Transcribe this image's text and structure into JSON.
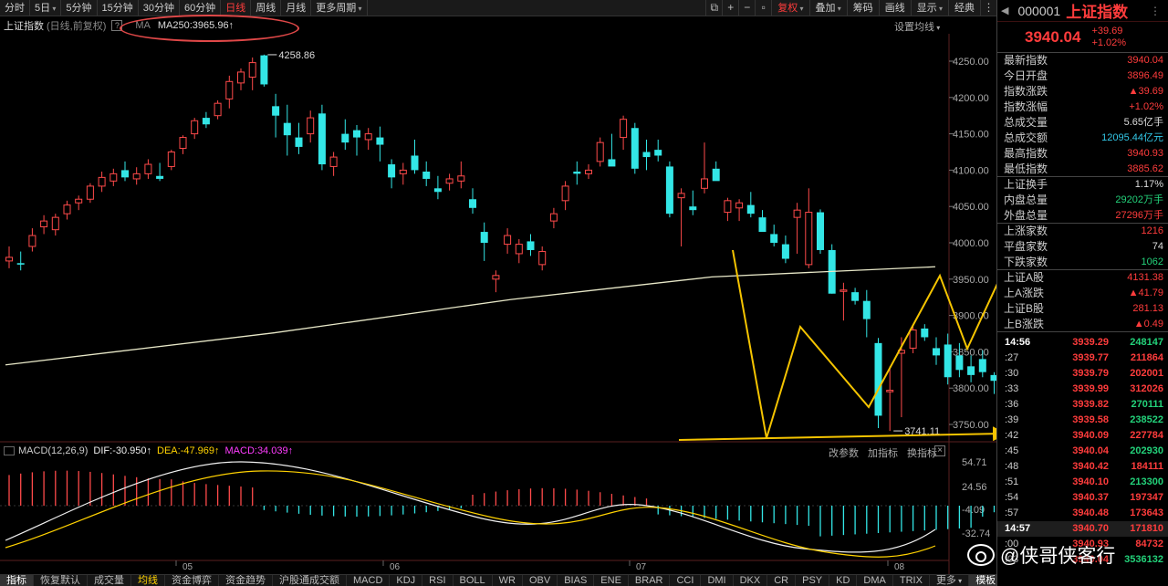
{
  "toolbar": {
    "periods": [
      "分时",
      "5日",
      "5分钟",
      "15分钟",
      "30分钟",
      "60分钟",
      "日线",
      "周线",
      "月线",
      "更多周期"
    ],
    "active_period": "日线",
    "right_buttons": [
      "复权",
      "叠加",
      "筹码",
      "画线",
      "显示",
      "经典"
    ]
  },
  "info": {
    "index_name": "上证指数",
    "options": "(日线,前复权)",
    "ma_label": "MA",
    "ma_value": "MA250:3965.96↑",
    "settings": "设置均线"
  },
  "price_axis": [
    "4250.00",
    "4200.00",
    "4150.00",
    "4100.00",
    "4050.00",
    "4000.00",
    "3950.00",
    "3900.00",
    "3850.00",
    "3800.00",
    "3750.00"
  ],
  "annotations": {
    "high": "4258.86",
    "low": "3741.11"
  },
  "macd": {
    "name": "MACD(12,26,9)",
    "dif": "DIF:-30.950↑",
    "dea": "DEA:-47.969↑",
    "macd": "MACD:34.039↑",
    "tools": [
      "改参数",
      "加指标",
      "换指标"
    ],
    "axis": [
      "54.71",
      "24.56",
      "-4.09",
      "-32.74"
    ]
  },
  "months": [
    "05",
    "06",
    "07",
    "08"
  ],
  "indicators": [
    "指标",
    "恢复默认",
    "成交量",
    "均线",
    "资金博弈",
    "资金趋势",
    "沪股通成交额",
    "MACD",
    "KDJ",
    "RSI",
    "BOLL",
    "WR",
    "OBV",
    "BIAS",
    "ENE",
    "BRAR",
    "CCI",
    "DMI",
    "DKX",
    "CR",
    "PSY",
    "KD",
    "DMA",
    "TRIX",
    "更多",
    "模板"
  ],
  "panel": {
    "code": "000001",
    "name": "上证指数",
    "price": "3940.04",
    "change": "+39.69",
    "change_pct": "+1.02%",
    "stats": [
      {
        "label": "最新指数",
        "value": "3940.04",
        "color": "red"
      },
      {
        "label": "今日开盘",
        "value": "3896.49",
        "color": "red"
      },
      {
        "label": "指数涨跌",
        "value": "▲39.69",
        "color": "red"
      },
      {
        "label": "指数涨幅",
        "value": "+1.02%",
        "color": "red"
      },
      {
        "label": "总成交量",
        "value": "5.65亿手",
        "color": "white"
      },
      {
        "label": "总成交额",
        "value": "12095.44亿元",
        "color": "cyan"
      },
      {
        "label": "最高指数",
        "value": "3940.93",
        "color": "red"
      },
      {
        "label": "最低指数",
        "value": "3885.62",
        "color": "red"
      }
    ],
    "stats2": [
      {
        "label": "上证换手",
        "value": "1.17%",
        "color": "white"
      },
      {
        "label": "内盘总量",
        "value": "29202万手",
        "color": "green"
      },
      {
        "label": "外盘总量",
        "value": "27296万手",
        "color": "red"
      }
    ],
    "stats3": [
      {
        "label": "上涨家数",
        "value": "1216",
        "color": "red"
      },
      {
        "label": "平盘家数",
        "value": "74",
        "color": "white"
      },
      {
        "label": "下跌家数",
        "value": "1062",
        "color": "green"
      }
    ],
    "stats4": [
      {
        "label": "上证A股",
        "value": "4131.38",
        "color": "red"
      },
      {
        "label": "上A涨跌",
        "value": "▲41.79",
        "color": "red"
      },
      {
        "label": "上证B股",
        "value": "281.13",
        "color": "red"
      },
      {
        "label": "上B涨跌",
        "value": "▲0.49",
        "color": "red"
      }
    ],
    "ticks": [
      {
        "t": "14:56",
        "p": "3939.29",
        "v": "248147",
        "pc": "red",
        "vc": "green",
        "strong": true
      },
      {
        "t": ":27",
        "p": "3939.77",
        "v": "211864",
        "pc": "red",
        "vc": "red"
      },
      {
        "t": ":30",
        "p": "3939.79",
        "v": "202001",
        "pc": "red",
        "vc": "red"
      },
      {
        "t": ":33",
        "p": "3939.99",
        "v": "312026",
        "pc": "red",
        "vc": "red"
      },
      {
        "t": ":36",
        "p": "3939.82",
        "v": "270111",
        "pc": "red",
        "vc": "green"
      },
      {
        "t": ":39",
        "p": "3939.58",
        "v": "238522",
        "pc": "red",
        "vc": "green"
      },
      {
        "t": ":42",
        "p": "3940.09",
        "v": "227784",
        "pc": "red",
        "vc": "red"
      },
      {
        "t": ":45",
        "p": "3940.04",
        "v": "202930",
        "pc": "red",
        "vc": "green"
      },
      {
        "t": ":48",
        "p": "3940.42",
        "v": "184111",
        "pc": "red",
        "vc": "red"
      },
      {
        "t": ":51",
        "p": "3940.10",
        "v": "213300",
        "pc": "red",
        "vc": "green"
      },
      {
        "t": ":54",
        "p": "3940.37",
        "v": "197347",
        "pc": "red",
        "vc": "red"
      },
      {
        "t": ":57",
        "p": "3940.48",
        "v": "173643",
        "pc": "red",
        "vc": "red"
      },
      {
        "t": "14:57",
        "p": "3940.70",
        "v": "171810",
        "pc": "red",
        "vc": "red",
        "strong": true
      },
      {
        "t": ":00",
        "p": "3940.93",
        "v": "84732",
        "pc": "red",
        "vc": "red"
      },
      {
        "t": ":03",
        "p": "3940.04",
        "v": "3536132",
        "pc": "red",
        "vc": "green"
      }
    ]
  },
  "watermark": "@侠哥侠客行",
  "colors": {
    "up": "#ff4a4a",
    "down": "#33e6e6",
    "annotation": "#f5c400",
    "ellipse": "#e04848"
  }
}
